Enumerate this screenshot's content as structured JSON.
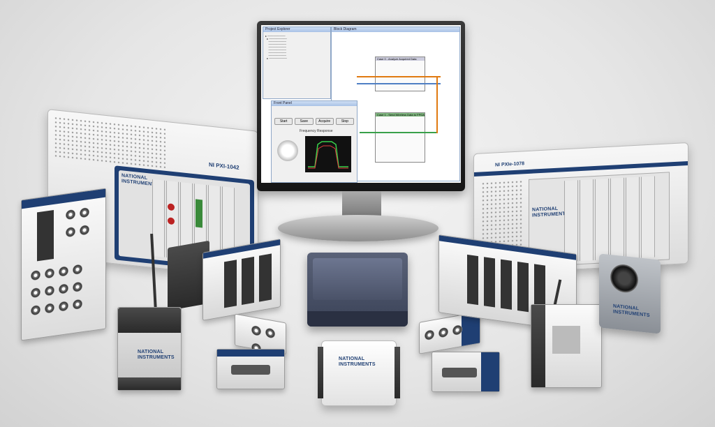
{
  "image": {
    "brand_text": "NATIONAL INSTRUMENTS",
    "chassis_left_label": "NI PXI-1042",
    "chassis_right_label": "NI PXIe-1078",
    "screen": {
      "project_window_title": "Project Explorer",
      "block_diagram_title": "Block Diagram",
      "front_panel_title": "Front Panel",
      "front_panel_section": "Frequency Response",
      "case_top_label": "Case 0 - Analyze Acquired Data",
      "case_bottom_label": "Case 1 - Send Wireless Data to FPGA",
      "buttons": [
        "Start",
        "Save",
        "Acquire",
        "Stop"
      ]
    }
  },
  "colors": {
    "ni_blue": "#1f3f73",
    "wire_orange": "#e07a10",
    "wire_blue": "#4f7fc4",
    "wire_green": "#39a04a"
  }
}
